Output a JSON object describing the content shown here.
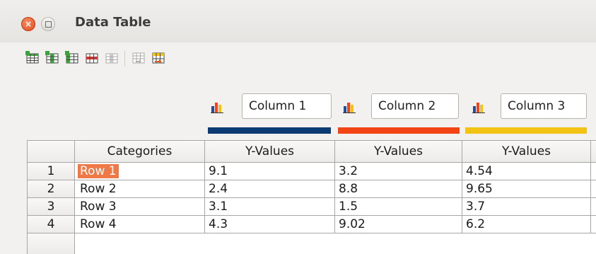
{
  "window": {
    "title": "Data Table",
    "close_glyph": "×"
  },
  "toolbar": {
    "buttons": [
      {
        "name": "insert-row-icon",
        "color": "#3aa33a"
      },
      {
        "name": "insert-series-icon",
        "color": "#3aa33a"
      },
      {
        "name": "insert-text-column-icon",
        "color": "#3aa33a"
      },
      {
        "name": "delete-row-icon",
        "color": "#d93030"
      },
      {
        "name": "delete-series-icon",
        "color": "#a0a0a0"
      },
      {
        "name": "move-series-left-icon",
        "color": "#a0a0a0"
      },
      {
        "name": "move-series-right-icon",
        "color": "#e05a1a"
      }
    ]
  },
  "series": [
    {
      "name": "Column 1",
      "color": "#0c3b73"
    },
    {
      "name": "Column 2",
      "color": "#f24415"
    },
    {
      "name": "Column 3",
      "color": "#f2c315"
    }
  ],
  "table": {
    "headers": [
      "",
      "Categories",
      "Y-Values",
      "Y-Values",
      "Y-Values"
    ],
    "rows": [
      {
        "num": "1",
        "category": "Row 1",
        "values": [
          "9.1",
          "3.2",
          "4.54"
        ]
      },
      {
        "num": "2",
        "category": "Row 2",
        "values": [
          "2.4",
          "8.8",
          "9.65"
        ]
      },
      {
        "num": "3",
        "category": "Row 3",
        "values": [
          "3.1",
          "1.5",
          "3.7"
        ]
      },
      {
        "num": "4",
        "category": "Row 4",
        "values": [
          "4.3",
          "9.02",
          "6.2"
        ]
      }
    ],
    "selected_cell": "Row 1"
  }
}
